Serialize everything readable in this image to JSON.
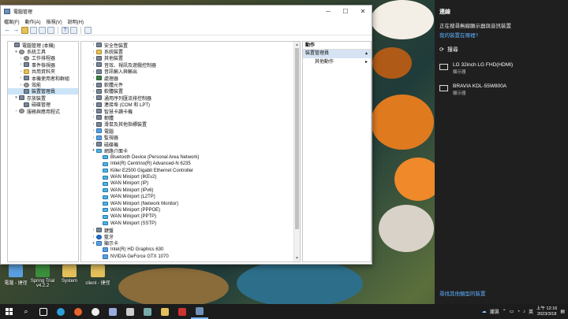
{
  "window": {
    "title": "電腦管理",
    "menu": [
      "檔案(F)",
      "動作(A)",
      "檢視(V)",
      "說明(H)"
    ]
  },
  "left_tree": [
    {
      "label": "電腦管理 (本機)",
      "indent": 0,
      "arrow": "",
      "icon": "device"
    },
    {
      "label": "系統工具",
      "indent": 1,
      "arrow": "▾",
      "icon": "gear"
    },
    {
      "label": "工作排程器",
      "indent": 2,
      "arrow": "›",
      "icon": "gear"
    },
    {
      "label": "事件檢視器",
      "indent": 2,
      "arrow": "›",
      "icon": "device"
    },
    {
      "label": "共用資料夾",
      "indent": 2,
      "arrow": "›",
      "icon": "folder"
    },
    {
      "label": "本機使用者和群組",
      "indent": 2,
      "arrow": "›",
      "icon": "device"
    },
    {
      "label": "效能",
      "indent": 2,
      "arrow": "›",
      "icon": "gear"
    },
    {
      "label": "裝置管理員",
      "indent": 2,
      "arrow": "",
      "icon": "device",
      "selected": true
    },
    {
      "label": "存放裝置",
      "indent": 1,
      "arrow": "▾",
      "icon": "device"
    },
    {
      "label": "磁碟管理",
      "indent": 2,
      "arrow": "",
      "icon": "device"
    },
    {
      "label": "服務與應用程式",
      "indent": 1,
      "arrow": "›",
      "icon": "gear"
    }
  ],
  "device_tree": [
    {
      "label": "安全性裝置",
      "indent": 1,
      "arrow": "›",
      "icon": "device"
    },
    {
      "label": "系統裝置",
      "indent": 1,
      "arrow": "›",
      "icon": "folder"
    },
    {
      "label": "其他裝置",
      "indent": 1,
      "arrow": "›",
      "icon": "device"
    },
    {
      "label": "音效、視訊及遊戲控制器",
      "indent": 1,
      "arrow": "›",
      "icon": "device"
    },
    {
      "label": "音訊輸入與輸出",
      "indent": 1,
      "arrow": "›",
      "icon": "device"
    },
    {
      "label": "處理器",
      "indent": 1,
      "arrow": "›",
      "icon": "chip"
    },
    {
      "label": "軟體元件",
      "indent": 1,
      "arrow": "›",
      "icon": "device"
    },
    {
      "label": "軟體裝置",
      "indent": 1,
      "arrow": "›",
      "icon": "device"
    },
    {
      "label": "通用序列匯流排控制器",
      "indent": 1,
      "arrow": "›",
      "icon": "device"
    },
    {
      "label": "連接埠 (COM 和 LPT)",
      "indent": 1,
      "arrow": "›",
      "icon": "device"
    },
    {
      "label": "智慧卡讀卡機",
      "indent": 1,
      "arrow": "›",
      "icon": "device"
    },
    {
      "label": "韌體",
      "indent": 1,
      "arrow": "›",
      "icon": "device"
    },
    {
      "label": "滑鼠及其他指標裝置",
      "indent": 1,
      "arrow": "›",
      "icon": "device"
    },
    {
      "label": "電腦",
      "indent": 1,
      "arrow": "›",
      "icon": "monitor"
    },
    {
      "label": "監視器",
      "indent": 1,
      "arrow": "›",
      "icon": "monitor"
    },
    {
      "label": "磁碟機",
      "indent": 1,
      "arrow": "›",
      "icon": "device"
    },
    {
      "label": "網路介面卡",
      "indent": 1,
      "arrow": "▾",
      "icon": "net"
    },
    {
      "label": "Bluetooth Device (Personal Area Network)",
      "indent": 2,
      "arrow": "",
      "icon": "net"
    },
    {
      "label": "Intel(R) Centrino(R) Advanced-N 6235",
      "indent": 2,
      "arrow": "",
      "icon": "net"
    },
    {
      "label": "Killer E2500 Gigabit Ethernet Controller",
      "indent": 2,
      "arrow": "",
      "icon": "net"
    },
    {
      "label": "WAN Miniport (IKEv2)",
      "indent": 2,
      "arrow": "",
      "icon": "net"
    },
    {
      "label": "WAN Miniport (IP)",
      "indent": 2,
      "arrow": "",
      "icon": "net"
    },
    {
      "label": "WAN Miniport (IPv6)",
      "indent": 2,
      "arrow": "",
      "icon": "net"
    },
    {
      "label": "WAN Miniport (L2TP)",
      "indent": 2,
      "arrow": "",
      "icon": "net"
    },
    {
      "label": "WAN Miniport (Network Monitor)",
      "indent": 2,
      "arrow": "",
      "icon": "net"
    },
    {
      "label": "WAN Miniport (PPPOE)",
      "indent": 2,
      "arrow": "",
      "icon": "net"
    },
    {
      "label": "WAN Miniport (PPTP)",
      "indent": 2,
      "arrow": "",
      "icon": "net"
    },
    {
      "label": "WAN Miniport (SSTP)",
      "indent": 2,
      "arrow": "",
      "icon": "net"
    },
    {
      "label": "鍵盤",
      "indent": 1,
      "arrow": "›",
      "icon": "device"
    },
    {
      "label": "藍牙",
      "indent": 1,
      "arrow": "›",
      "icon": "bt"
    },
    {
      "label": "顯示卡",
      "indent": 1,
      "arrow": "▾",
      "icon": "monitor"
    },
    {
      "label": "Intel(R) HD Graphics 630",
      "indent": 2,
      "arrow": "",
      "icon": "monitor"
    },
    {
      "label": "NVIDIA GeForce GTX 1070",
      "indent": 2,
      "arrow": "",
      "icon": "monitor"
    }
  ],
  "actions": {
    "header": "動作",
    "section": "裝置管理員",
    "more": "其他動作"
  },
  "project": {
    "title": "連線",
    "desc": "正在搜尋無線顯示器與音訊裝置",
    "link": "我的裝置在哪裡?",
    "search": "搜尋",
    "devices": [
      {
        "name": "LG 32inch LG FHD(HDMI)",
        "type": "顯示器"
      },
      {
        "name": "BRAVIA KDL-55W800A",
        "type": "顯示器"
      }
    ],
    "bottom_link": "尋找其他類型的裝置"
  },
  "desktop_icons": [
    {
      "label": "電腦 - 捷徑"
    },
    {
      "label": "Spring Trial v4.2.2"
    },
    {
      "label": "System"
    },
    {
      "label": "client - 捷徑"
    }
  ],
  "tray": {
    "ime": "英",
    "time": "上午 12:16",
    "date": "2023/3/18",
    "weather": "潮濕"
  }
}
